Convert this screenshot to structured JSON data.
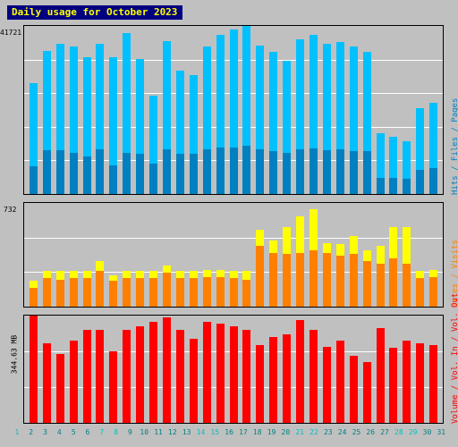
{
  "title": "Daily usage for October 2023",
  "colors": {
    "background": "#c0c0c0",
    "title_bg": "#000080",
    "title_fg": "#ffff00",
    "hits": "#00ffff",
    "files": "#00c0ff",
    "pages": "#00a0d0",
    "visits": "#ffff00",
    "sites": "#ff8000",
    "kbytes_in": "#ff0000",
    "kbytes_out": "#cc0000",
    "grid": "#ffffff",
    "axis": "#000000",
    "weekend_label": "#00c0c0",
    "weekday_label": "#008080"
  },
  "legends": {
    "top": [
      {
        "label": "Hits",
        "color": "#00ffff"
      },
      {
        "label": "Files",
        "color": "#00c0ff"
      },
      {
        "label": "Pages",
        "color": "#0080c0"
      }
    ],
    "middle": [
      {
        "label": "Visits",
        "color": "#ffff00"
      },
      {
        "label": "Sites",
        "color": "#ff8000"
      }
    ],
    "bottom": [
      {
        "label": "Vol. Out",
        "color": "#ff0000"
      },
      {
        "label": "Vol. In",
        "color": "#cc0000"
      },
      {
        "label": "Volume",
        "color": "#aa0000"
      }
    ],
    "top_text": "Hits / Files / Pages",
    "middle_text": "Sites / Visits",
    "bottom_text": "Volume / Vol. In / Vol. Out"
  },
  "axis_labels": {
    "top_max": "41721",
    "middle_max": "732",
    "bottom_max": "344.63 MB"
  },
  "chart_data": {
    "type": "bar",
    "title": "Daily usage for October 2023",
    "xlabel": "",
    "ylabel": "",
    "grid": true,
    "legend_position": "right-rotated",
    "categories": [
      "1",
      "2",
      "3",
      "4",
      "5",
      "6",
      "7",
      "8",
      "9",
      "10",
      "11",
      "12",
      "13",
      "14",
      "15",
      "16",
      "17",
      "18",
      "19",
      "20",
      "21",
      "22",
      "23",
      "24",
      "25",
      "26",
      "27",
      "28",
      "29",
      "30",
      "31"
    ],
    "weekend_days": [
      1,
      7,
      8,
      14,
      15,
      21,
      22,
      28,
      29
    ],
    "panels": [
      {
        "name": "hits-files-pages",
        "ylim": [
          0,
          41721
        ],
        "ytick_label": "41721",
        "series": [
          {
            "name": "Hits",
            "color": "#00ffff",
            "values": [
              27600,
              35500,
              37200,
              36600,
              34000,
              37300,
              33900,
              39900,
              33500,
              24500,
              37900,
              30700,
              29600,
              36600,
              39600,
              40900,
              41721,
              36900,
              35200,
              33100,
              38500,
              39400,
              37200,
              37800,
              36700,
              35300,
              15000,
              14200,
              13100,
              21300,
              22600
            ]
          },
          {
            "name": "Files",
            "color": "#00c0ff",
            "values": [
              27600,
              35500,
              37200,
              36600,
              34000,
              37300,
              33900,
              39900,
              33500,
              24500,
              37900,
              30700,
              29600,
              36600,
              39600,
              40900,
              41721,
              36900,
              35200,
              33100,
              38500,
              39400,
              37200,
              37800,
              36700,
              35300,
              15000,
              14200,
              13100,
              21300,
              22600
            ]
          },
          {
            "name": "Pages",
            "color": "#0080c0",
            "values": [
              6800,
              10800,
              10800,
              10100,
              9300,
              11100,
              7000,
              10300,
              9900,
              7600,
              11100,
              9900,
              10000,
              11200,
              11600,
              11600,
              11900,
              11200,
              10600,
              10100,
              11100,
              11400,
              10900,
              11200,
              10700,
              10600,
              4100,
              3900,
              3700,
              6000,
              6500
            ]
          }
        ]
      },
      {
        "name": "sites-visits",
        "ylim": [
          0,
          732
        ],
        "ytick_label": "732",
        "series": [
          {
            "name": "Visits",
            "color": "#ffff00",
            "values": [
              180,
              250,
              250,
              250,
              250,
              320,
              220,
              250,
              250,
              250,
              290,
              250,
              250,
              260,
              260,
              250,
              250,
              540,
              470,
              560,
              640,
              690,
              450,
              440,
              500,
              400,
              430,
              560,
              560,
              250,
              260
            ]
          },
          {
            "name": "Sites",
            "color": "#ff8000",
            "values": [
              130,
              200,
              190,
              200,
              200,
              250,
              180,
              200,
              200,
              200,
              240,
              200,
              200,
              210,
              210,
              200,
              190,
              430,
              380,
              370,
              380,
              400,
              380,
              360,
              370,
              320,
              300,
              340,
              300,
              200,
              210
            ]
          }
        ]
      },
      {
        "name": "volume",
        "ylim": [
          0,
          344.63
        ],
        "ytick_label": "344.63 MB",
        "unit": "MB",
        "series": [
          {
            "name": "Volume",
            "color": "#ff0000",
            "values": [
              344.63,
              255.0,
              220.0,
              265.0,
              300.0,
              300.0,
              230.0,
              300.0,
              310.0,
              325.0,
              340.0,
              300.0,
              270.0,
              325.0,
              320.0,
              310.0,
              300.0,
              250.0,
              275.0,
              285.0,
              330.0,
              300.0,
              245.0,
              265.0,
              215.0,
              195.0,
              305.0,
              240.0,
              265.0,
              255.0,
              250.0
            ]
          }
        ]
      }
    ]
  },
  "x_tick_labels": [
    "1",
    "2",
    "3",
    "4",
    "5",
    "6",
    "7",
    "8",
    "9",
    "10",
    "11",
    "12",
    "13",
    "14",
    "15",
    "16",
    "17",
    "18",
    "19",
    "20",
    "21",
    "22",
    "23",
    "24",
    "25",
    "26",
    "27",
    "28",
    "29",
    "30",
    "31"
  ]
}
